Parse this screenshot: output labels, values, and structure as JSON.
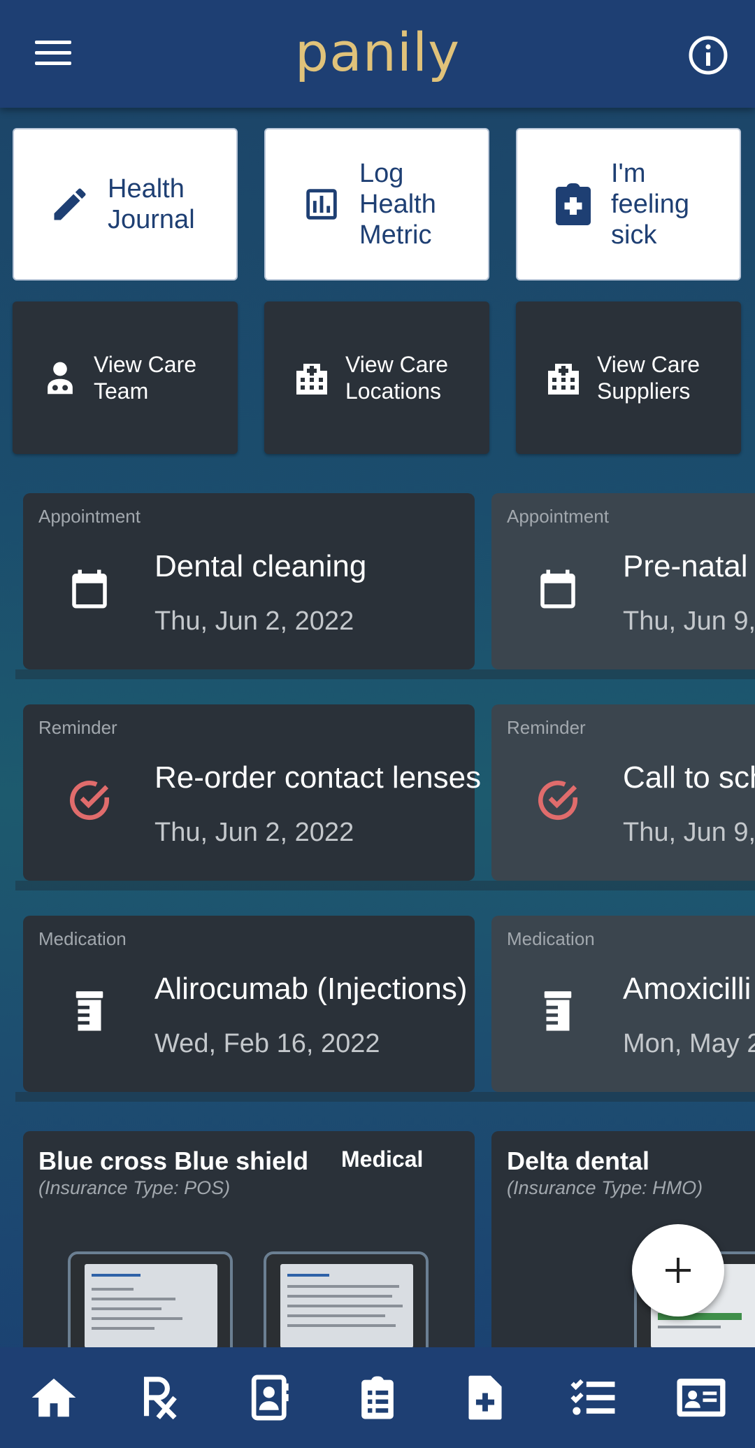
{
  "app": {
    "brand": "panily"
  },
  "quick_actions": [
    {
      "label_lines": [
        "Health",
        "Journal"
      ],
      "icon": "pencil-icon"
    },
    {
      "label_lines": [
        "Log",
        "Health",
        "Metric"
      ],
      "icon": "bar-chart-icon"
    },
    {
      "label_lines": [
        "I'm",
        "feeling",
        "sick"
      ],
      "icon": "clipboard-plus-icon"
    }
  ],
  "care_links": [
    {
      "label_lines": [
        "View Care",
        "Team"
      ],
      "icon": "doctor-icon"
    },
    {
      "label_lines": [
        "View Care",
        "Locations"
      ],
      "icon": "hospital-icon"
    },
    {
      "label_lines": [
        "View Care",
        "Suppliers"
      ],
      "icon": "hospital-icon"
    }
  ],
  "timeline": {
    "appointments": [
      {
        "category": "Appointment",
        "title": "Dental cleaning",
        "date": "Thu, Jun 2, 2022",
        "icon": "calendar-icon"
      },
      {
        "category": "Appointment",
        "title": "Pre-natal c",
        "date": "Thu, Jun 9,",
        "icon": "calendar-icon"
      }
    ],
    "reminders": [
      {
        "category": "Reminder",
        "title": "Re-order contact lenses",
        "date": "Thu, Jun 2, 2022",
        "icon": "check-circle-icon"
      },
      {
        "category": "Reminder",
        "title": "Call to sch",
        "date": "Thu, Jun 9,",
        "icon": "check-circle-icon"
      }
    ],
    "medications": [
      {
        "category": "Medication",
        "title": "Alirocumab (Injections)",
        "date": "Wed, Feb 16, 2022",
        "icon": "pill-bottle-icon"
      },
      {
        "category": "Medication",
        "title": "Amoxicilli",
        "date": "Mon, May 2",
        "icon": "pill-bottle-icon"
      }
    ]
  },
  "insurance": [
    {
      "name": "Blue cross Blue shield",
      "type": "(Insurance Type: POS)",
      "plan": "Medical"
    },
    {
      "name": "Delta dental",
      "type": "(Insurance Type: HMO)",
      "plan": ""
    }
  ],
  "bottom_nav": [
    {
      "icon": "home-icon"
    },
    {
      "icon": "rx-icon",
      "label": "Rx"
    },
    {
      "icon": "contacts-icon"
    },
    {
      "icon": "clipboard-list-icon"
    },
    {
      "icon": "file-plus-icon"
    },
    {
      "icon": "checklist-icon"
    },
    {
      "icon": "id-card-icon"
    }
  ],
  "colors": {
    "appbar": "#1e3f73",
    "brand": "#e0c27a",
    "card": "#2a3139",
    "reminder_icon": "#e06c6c"
  }
}
